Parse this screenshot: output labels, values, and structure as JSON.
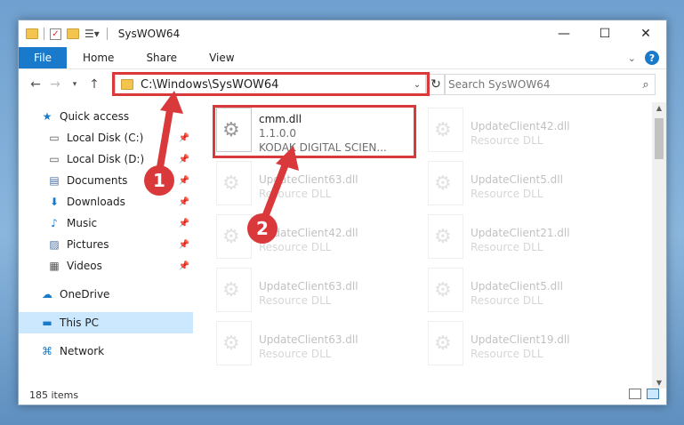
{
  "window": {
    "title": "SysWOW64",
    "controls": {
      "minimize": "—",
      "maximize": "☐",
      "close": "✕"
    }
  },
  "ribbon": {
    "file_tab": "File",
    "tabs": [
      "Home",
      "Share",
      "View"
    ],
    "help": "?"
  },
  "address": {
    "path": "C:\\Windows\\SysWOW64",
    "search_placeholder": "Search SysWOW64"
  },
  "nav": {
    "quick_access": "Quick access",
    "items": [
      {
        "label": "Local Disk (C:)",
        "icon": "drive-icon"
      },
      {
        "label": "Local Disk (D:)",
        "icon": "drive-icon"
      },
      {
        "label": "Documents",
        "icon": "documents-icon"
      },
      {
        "label": "Downloads",
        "icon": "downloads-icon"
      },
      {
        "label": "Music",
        "icon": "music-icon"
      },
      {
        "label": "Pictures",
        "icon": "pictures-icon"
      },
      {
        "label": "Videos",
        "icon": "videos-icon"
      }
    ],
    "onedrive": "OneDrive",
    "this_pc": "This PC",
    "network": "Network"
  },
  "files": {
    "selected": {
      "name": "cmm.dll",
      "version": "1.1.0.0",
      "company": "KODAK DIGITAL SCIEN..."
    },
    "faded": [
      {
        "name": "UpdateClient42.dll",
        "type": "Resource DLL"
      },
      {
        "name": "UpdateClient63.dll",
        "type": "Resource DLL"
      },
      {
        "name": "UpdateClient5.dll",
        "type": "Resource DLL"
      },
      {
        "name": "UpdateClient42.dll",
        "type": "Resource DLL"
      },
      {
        "name": "UpdateClient21.dll",
        "type": "Resource DLL"
      },
      {
        "name": "UpdateClient63.dll",
        "type": "Resource DLL"
      },
      {
        "name": "UpdateClient5.dll",
        "type": "Resource DLL"
      },
      {
        "name": "UpdateClient63.dll",
        "type": "Resource DLL"
      },
      {
        "name": "UpdateClient19.dll",
        "type": "Resource DLL"
      }
    ]
  },
  "status": {
    "count": "185 items"
  },
  "annotations": {
    "step1": "1",
    "step2": "2"
  },
  "colors": {
    "accent": "#1979ca",
    "callout": "#d9393b",
    "selection": "#cce8ff"
  }
}
